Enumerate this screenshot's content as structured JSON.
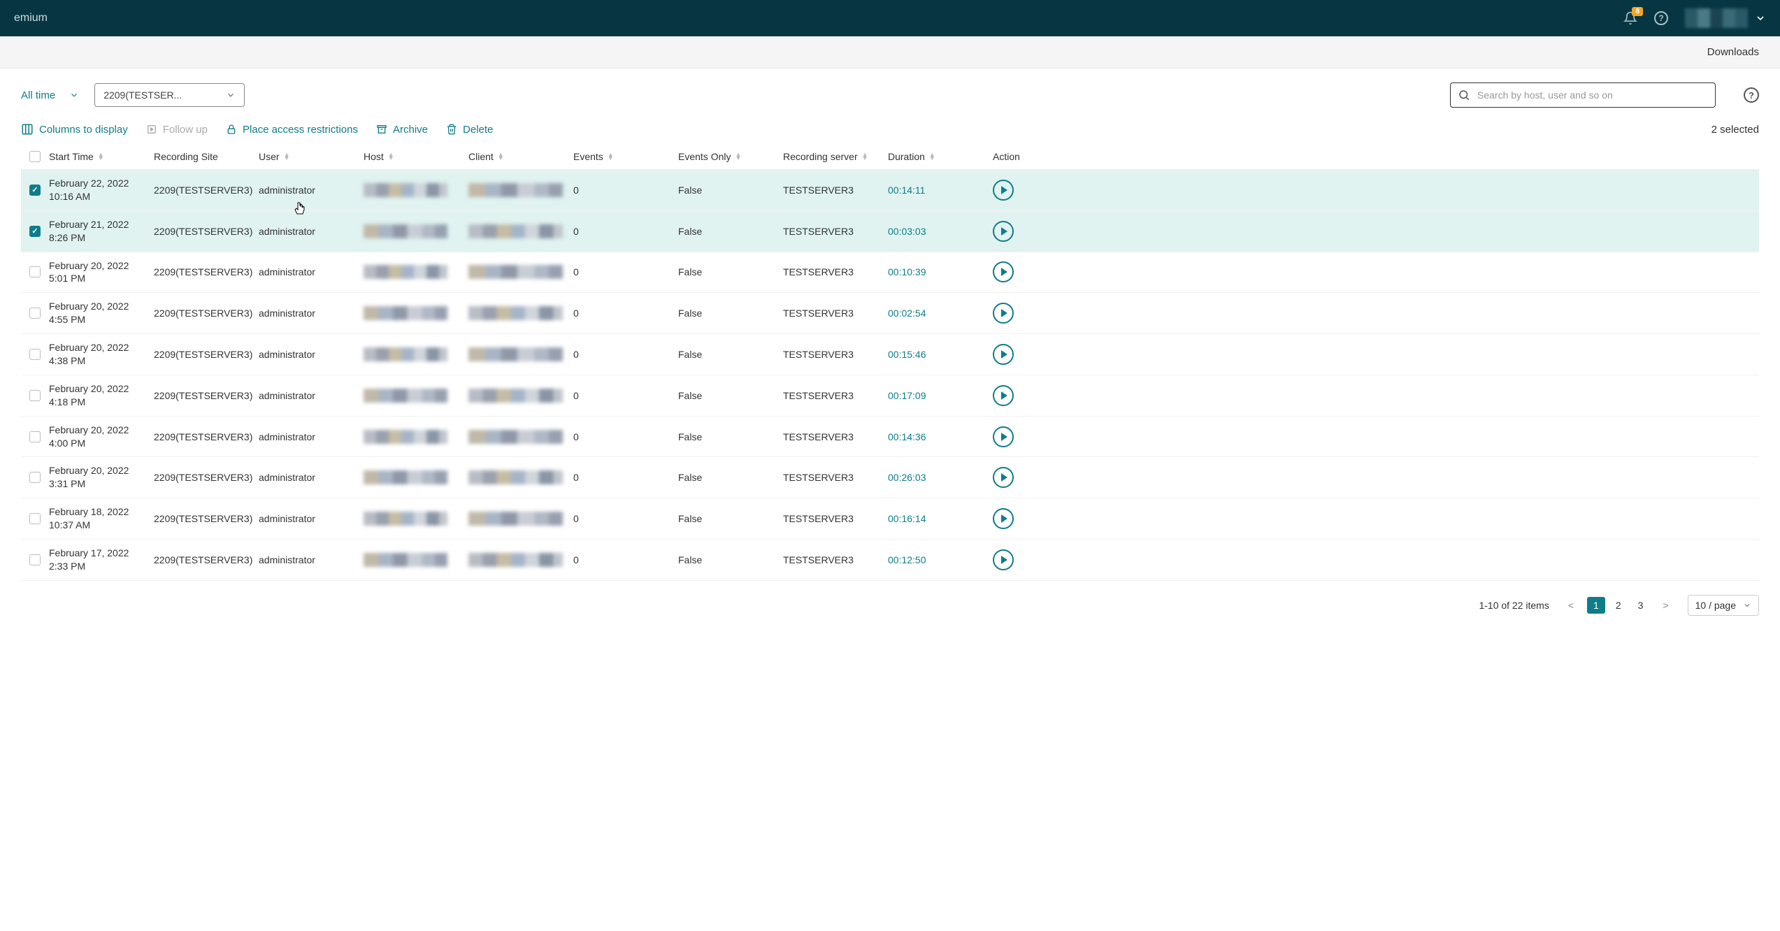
{
  "header": {
    "title_fragment": "emium",
    "notif_count": "8",
    "downloads": "Downloads"
  },
  "filters": {
    "time_label": "All time",
    "server_label": "2209(TESTSER...",
    "search_placeholder": "Search by host, user and so on"
  },
  "actions": {
    "columns": "Columns to display",
    "followup": "Follow up",
    "restrict": "Place access restrictions",
    "archive": "Archive",
    "delete": "Delete",
    "selected": "2 selected"
  },
  "columns": {
    "start": "Start Time",
    "site": "Recording Site",
    "user": "User",
    "host": "Host",
    "client": "Client",
    "events": "Events",
    "eonly": "Events Only",
    "server": "Recording server",
    "duration": "Duration",
    "action": "Action"
  },
  "rows": [
    {
      "checked": true,
      "date": "February 22, 2022",
      "time": "10:16 AM",
      "site": "2209(TESTSERVER3)",
      "user": "administrator",
      "events": "0",
      "eonly": "False",
      "server": "TESTSERVER3",
      "duration": "00:14:11"
    },
    {
      "checked": true,
      "date": "February 21, 2022",
      "time": "8:26 PM",
      "site": "2209(TESTSERVER3)",
      "user": "administrator",
      "events": "0",
      "eonly": "False",
      "server": "TESTSERVER3",
      "duration": "00:03:03"
    },
    {
      "checked": false,
      "date": "February 20, 2022",
      "time": "5:01 PM",
      "site": "2209(TESTSERVER3)",
      "user": "administrator",
      "events": "0",
      "eonly": "False",
      "server": "TESTSERVER3",
      "duration": "00:10:39"
    },
    {
      "checked": false,
      "date": "February 20, 2022",
      "time": "4:55 PM",
      "site": "2209(TESTSERVER3)",
      "user": "administrator",
      "events": "0",
      "eonly": "False",
      "server": "TESTSERVER3",
      "duration": "00:02:54"
    },
    {
      "checked": false,
      "date": "February 20, 2022",
      "time": "4:38 PM",
      "site": "2209(TESTSERVER3)",
      "user": "administrator",
      "events": "0",
      "eonly": "False",
      "server": "TESTSERVER3",
      "duration": "00:15:46"
    },
    {
      "checked": false,
      "date": "February 20, 2022",
      "time": "4:18 PM",
      "site": "2209(TESTSERVER3)",
      "user": "administrator",
      "events": "0",
      "eonly": "False",
      "server": "TESTSERVER3",
      "duration": "00:17:09"
    },
    {
      "checked": false,
      "date": "February 20, 2022",
      "time": "4:00 PM",
      "site": "2209(TESTSERVER3)",
      "user": "administrator",
      "events": "0",
      "eonly": "False",
      "server": "TESTSERVER3",
      "duration": "00:14:36"
    },
    {
      "checked": false,
      "date": "February 20, 2022",
      "time": "3:31 PM",
      "site": "2209(TESTSERVER3)",
      "user": "administrator",
      "events": "0",
      "eonly": "False",
      "server": "TESTSERVER3",
      "duration": "00:26:03"
    },
    {
      "checked": false,
      "date": "February 18, 2022",
      "time": "10:37 AM",
      "site": "2209(TESTSERVER3)",
      "user": "administrator",
      "events": "0",
      "eonly": "False",
      "server": "TESTSERVER3",
      "duration": "00:16:14"
    },
    {
      "checked": false,
      "date": "February 17, 2022",
      "time": "2:33 PM",
      "site": "2209(TESTSERVER3)",
      "user": "administrator",
      "events": "0",
      "eonly": "False",
      "server": "TESTSERVER3",
      "duration": "00:12:50"
    }
  ],
  "pager": {
    "summary": "1-10 of 22 items",
    "pages": [
      "1",
      "2",
      "3"
    ],
    "active": "1",
    "perpage": "10 / page"
  }
}
